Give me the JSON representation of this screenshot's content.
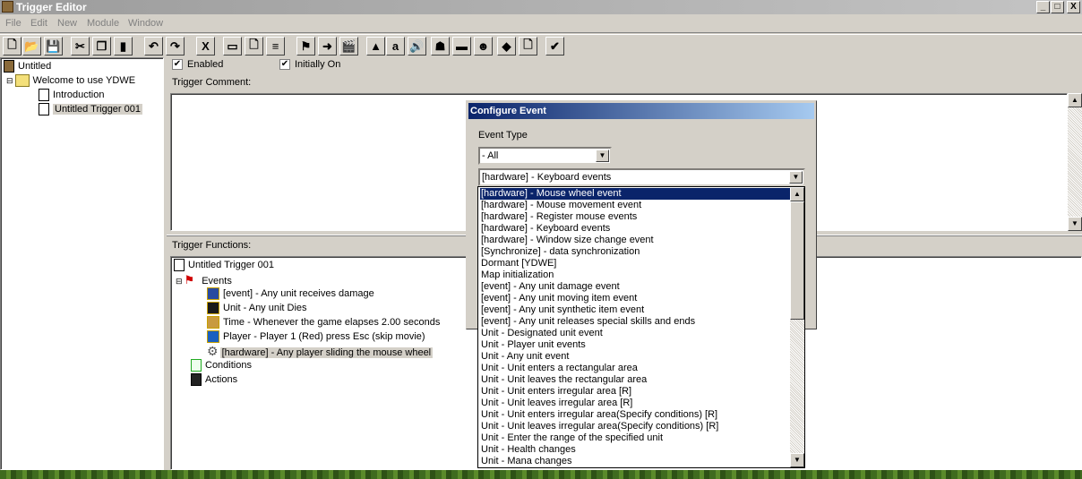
{
  "window": {
    "title": "Trigger Editor",
    "minimize": "_",
    "maximize": "□",
    "close": "X"
  },
  "menu": [
    "File",
    "Edit",
    "New",
    "Module",
    "Window"
  ],
  "toolbar": [
    {
      "icon": "new-icon",
      "g": "🗋"
    },
    {
      "icon": "open-icon",
      "g": "📂"
    },
    {
      "icon": "save-icon",
      "g": "💾"
    },
    {
      "icon": "cut-icon",
      "g": "✂"
    },
    {
      "icon": "copy-icon",
      "g": "❐"
    },
    {
      "icon": "paste-icon",
      "g": "▮"
    },
    {
      "icon": "undo-icon",
      "g": "↶"
    },
    {
      "icon": "redo-icon",
      "g": "↷"
    },
    {
      "icon": "delete-icon",
      "g": "X"
    },
    {
      "icon": "new-category-icon",
      "g": "▭"
    },
    {
      "icon": "new-trigger-icon",
      "g": "🗋"
    },
    {
      "icon": "new-comment-icon",
      "g": "≡"
    },
    {
      "icon": "new-event-icon",
      "g": "⚑"
    },
    {
      "icon": "new-condition-icon",
      "g": "➜"
    },
    {
      "icon": "new-action-icon",
      "g": "🎬"
    },
    {
      "icon": "terrain-editor-icon",
      "g": "▲"
    },
    {
      "icon": "trigger-editor-icon",
      "g": "a"
    },
    {
      "icon": "sound-editor-icon",
      "g": "🔊"
    },
    {
      "icon": "object-editor-icon",
      "g": "☗"
    },
    {
      "icon": "campaign-editor-icon",
      "g": "▬"
    },
    {
      "icon": "ai-editor-icon",
      "g": "☻"
    },
    {
      "icon": "import-manager-icon",
      "g": "◆"
    },
    {
      "icon": "script-editor-icon",
      "g": "🗋"
    },
    {
      "icon": "test-map-icon",
      "g": "✔"
    }
  ],
  "left_tree": {
    "root": "Untitled",
    "category": "Welcome to use YDWE",
    "items": [
      "Introduction",
      "Untitled Trigger 001"
    ]
  },
  "trigger": {
    "enabled_label": "Enabled",
    "initially_on_label": "Initially On",
    "comment_label": "Trigger Comment:",
    "functions_label": "Trigger Functions:"
  },
  "functions_tree": {
    "name": "Untitled Trigger 001",
    "events_label": "Events",
    "events": [
      {
        "text": "[event] - Any unit receives damage",
        "icon": "damage-icon"
      },
      {
        "text": "Unit - Any unit Dies",
        "icon": "unit-icon"
      },
      {
        "text": "Time - Whenever the game elapses 2.00 seconds",
        "icon": "clock-icon"
      },
      {
        "text": "Player - Player 1 (Red) press Esc (skip movie)",
        "icon": "player-icon"
      },
      {
        "text": "[hardware] - Any player sliding the mouse wheel",
        "icon": "gear-icon"
      }
    ],
    "conditions_label": "Conditions",
    "actions_label": "Actions"
  },
  "dialog": {
    "title": "Configure Event",
    "event_type_label": "Event Type",
    "event_type_value": "- All",
    "event_value": "[hardware] - Keyboard events",
    "options": [
      "[hardware] - Mouse wheel event",
      "[hardware] - Mouse movement event",
      "[hardware] - Register mouse events",
      "[hardware] - Keyboard events",
      "[hardware] - Window size change event",
      "[Synchronize] - data synchronization",
      "Dormant [YDWE]",
      "Map initialization",
      "[event] - Any unit damage event",
      "[event] - Any unit moving item event",
      "[event] - Any unit synthetic item event",
      "[event] - Any unit releases special skills and ends",
      "Unit - Designated unit event",
      "Unit - Player unit events",
      "Unit - Any unit event",
      "Unit - Unit enters a rectangular area",
      "Unit - Unit leaves the rectangular area",
      "Unit - Unit enters irregular area [R]",
      "Unit - Unit leaves irregular area [R]",
      "Unit - Unit enters irregular area(Specify conditions) [R]",
      "Unit - Unit leaves irregular area(Specify conditions) [R]",
      "Unit - Enter the range of the specified unit",
      "Unit - Health changes",
      "Unit - Mana changes"
    ],
    "selected_index": 0
  },
  "colors": {
    "selection": "#0a246a",
    "face": "#d4d0c8"
  }
}
